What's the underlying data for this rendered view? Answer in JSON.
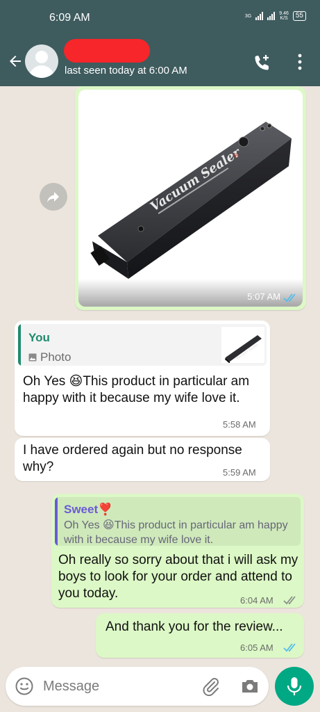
{
  "status_bar": {
    "time": "6:09 AM",
    "network_type": "3G",
    "net_speed_value": "9.46",
    "net_speed_unit": "K/S",
    "battery": "55"
  },
  "header": {
    "last_seen": "last seen today at 6:00 AM",
    "icons": [
      "back-arrow-icon",
      "avatar",
      "add-call-icon",
      "more-vert-icon"
    ]
  },
  "messages": [
    {
      "direction": "outgoing",
      "type": "image",
      "image_subject": "Vacuum Sealer product photo",
      "time": "5:07 AM",
      "status": "read"
    },
    {
      "direction": "incoming",
      "quote": {
        "author": "You",
        "type_label": "Photo"
      },
      "text": "Oh Yes 😆This product in particular am happy with it because my wife love it.",
      "time": "5:58 AM"
    },
    {
      "direction": "incoming",
      "text": "I have ordered again but no response why?",
      "time": "5:59 AM"
    },
    {
      "direction": "outgoing",
      "quote": {
        "author": "Sweet❣️",
        "text": "Oh Yes 😆This product in particular am happy with it because my wife love it."
      },
      "text": "Oh really so sorry about that i will ask my boys to look for your order and attend to you today.",
      "time": "6:04 AM",
      "status": "delivered"
    },
    {
      "direction": "outgoing",
      "text": "And thank you for the review...",
      "time": "6:05 AM",
      "status": "read"
    }
  ],
  "composer": {
    "placeholder": "Message",
    "icons": [
      "emoji-icon",
      "attach-icon",
      "camera-icon",
      "mic-icon"
    ]
  },
  "colors": {
    "header": "#3e5b5e",
    "outgoing_bubble": "#dcf8c6",
    "incoming_bubble": "#ffffff",
    "accent": "#00a884",
    "read_tick": "#53bdeb",
    "quote_you": "#1f8a6d",
    "quote_sweet": "#6a5ad6"
  }
}
